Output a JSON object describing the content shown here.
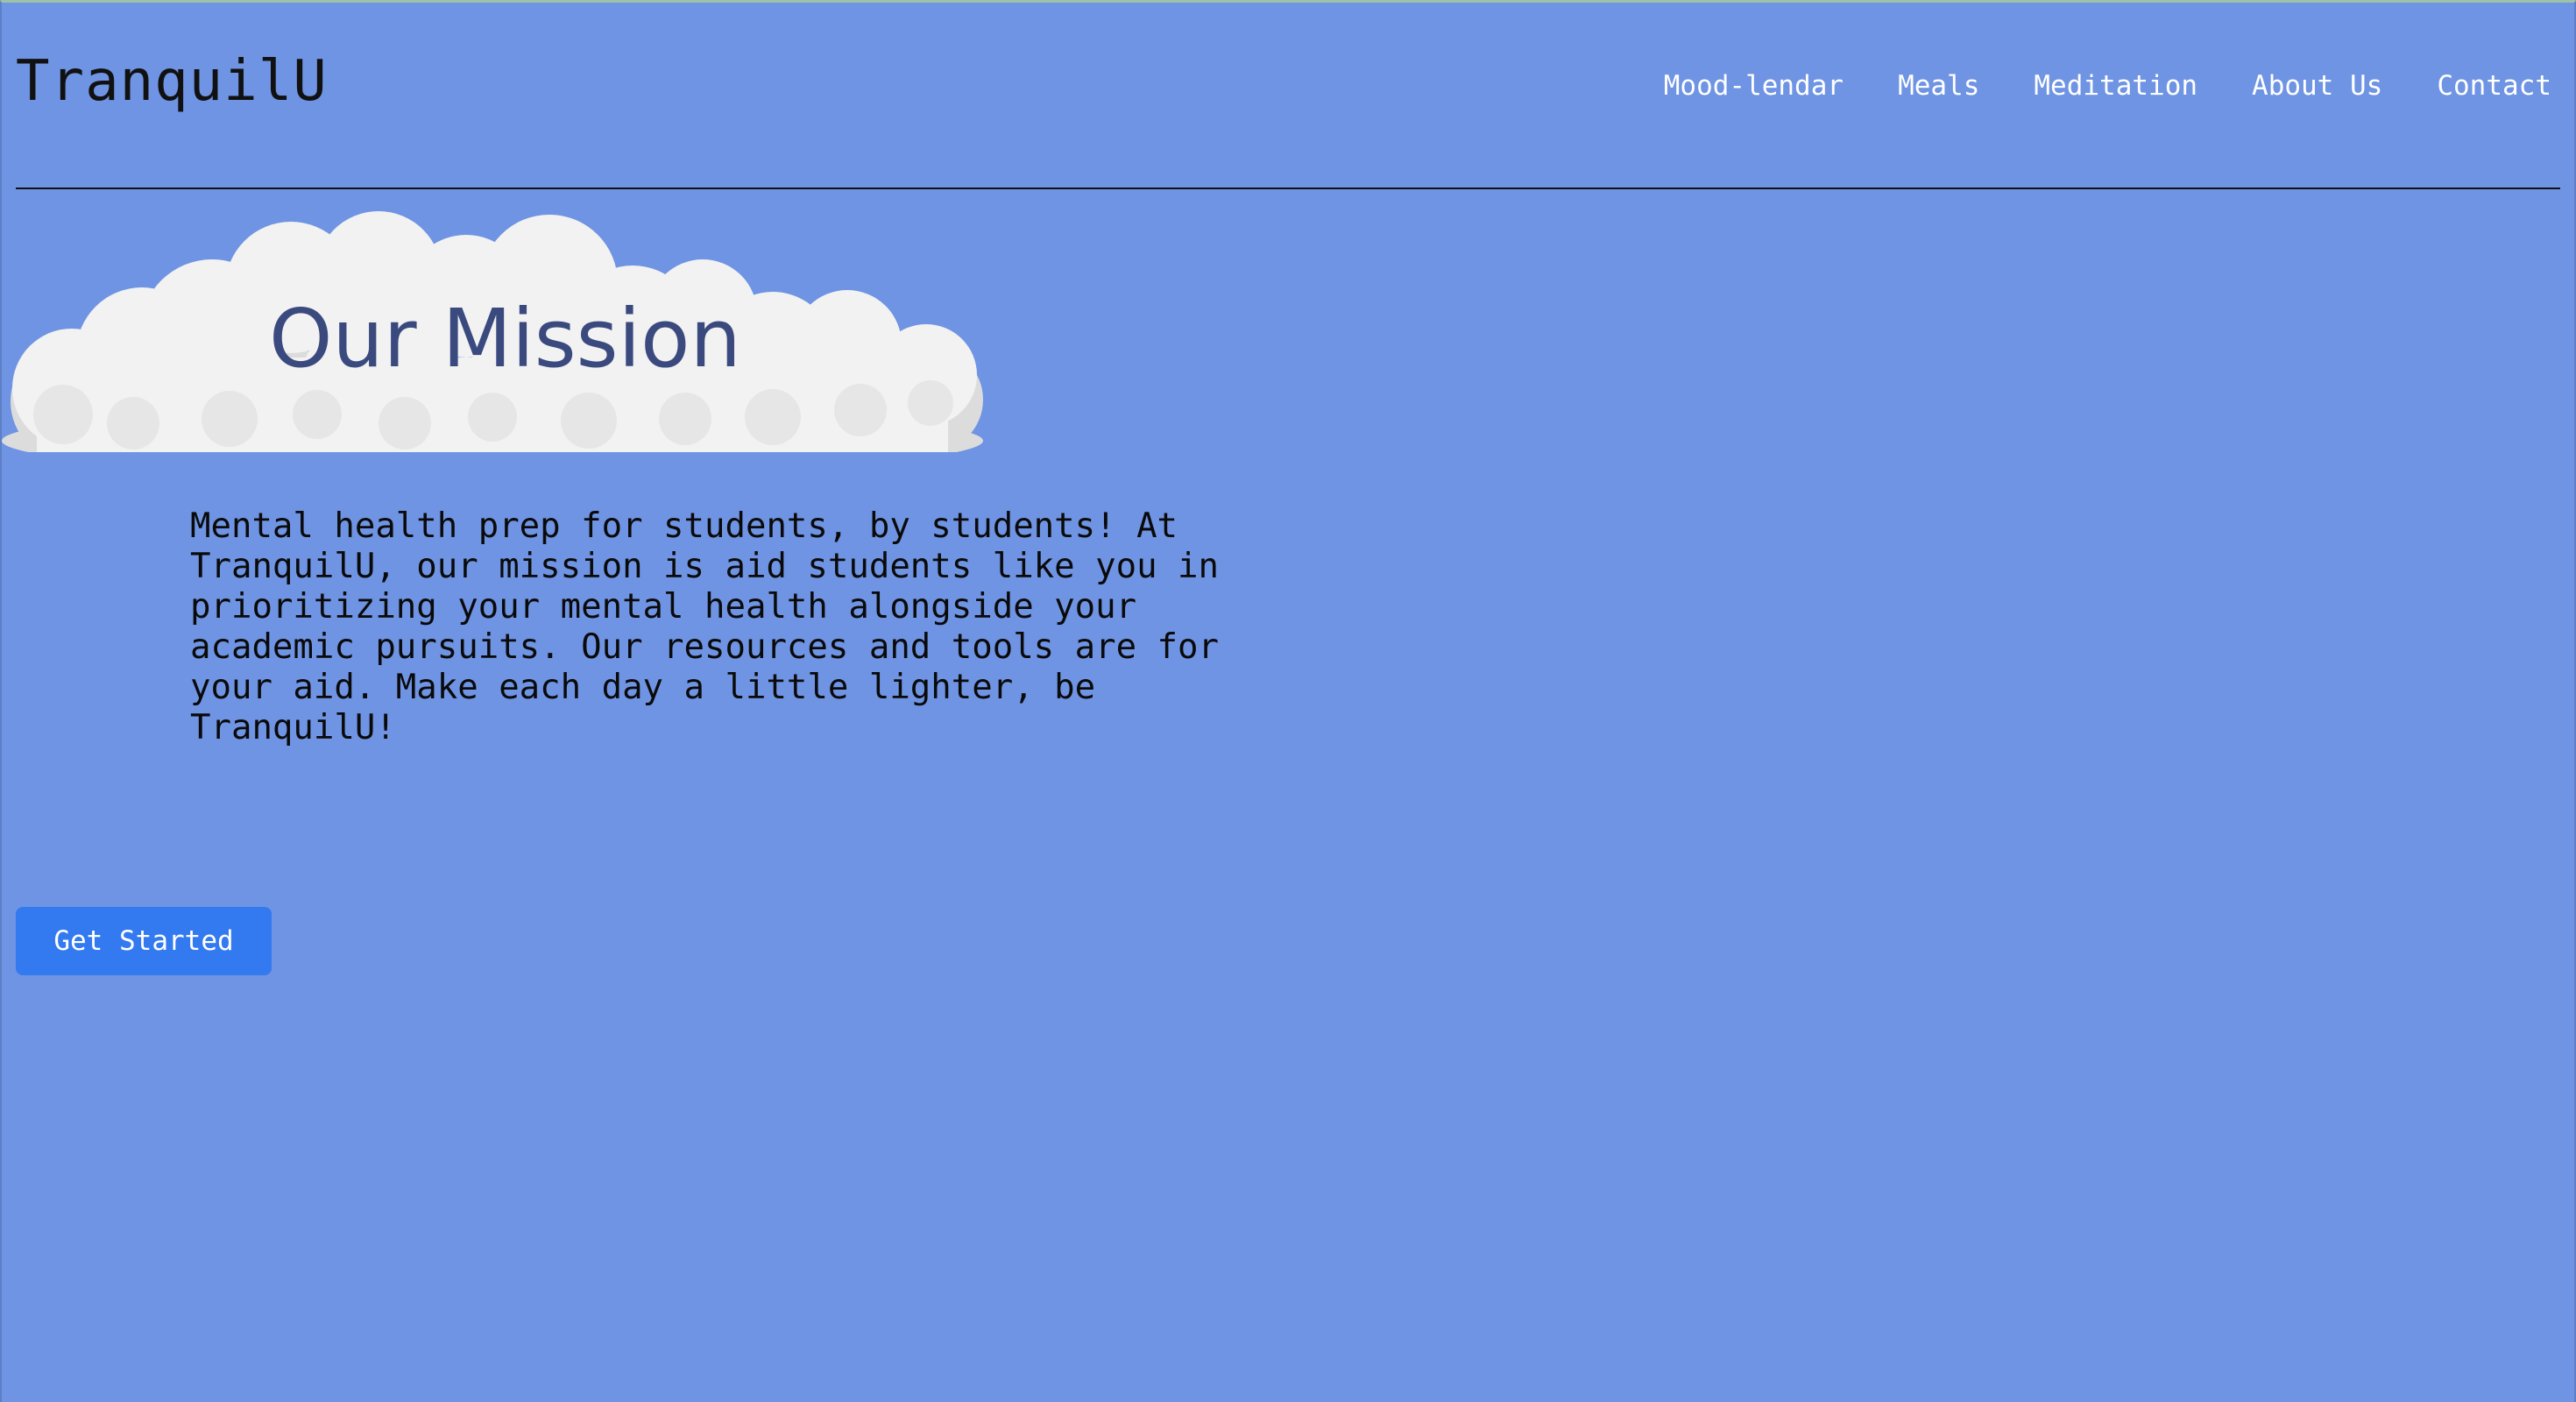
{
  "header": {
    "brand": "TranquilU",
    "nav": [
      {
        "label": "Mood-lendar"
      },
      {
        "label": "Meals"
      },
      {
        "label": "Meditation"
      },
      {
        "label": "About Us"
      },
      {
        "label": "Contact"
      }
    ]
  },
  "hero": {
    "title": "Our Mission",
    "body": "Mental health prep for students, by students! At TranquilU, our mission is aid students like you in prioritizing your mental health alongside your academic pursuits. Our resources and tools are for your aid. Make each day a little lighter, be TranquilU!",
    "cta_label": "Get Started"
  },
  "colors": {
    "background": "#6f94e3",
    "title": "#3b4a7e",
    "button": "#3379f0",
    "cloud": "#f2f2f2",
    "cloud_shadow": "#dcdcdc"
  },
  "icons": {
    "cloud": "cloud-illustration"
  }
}
